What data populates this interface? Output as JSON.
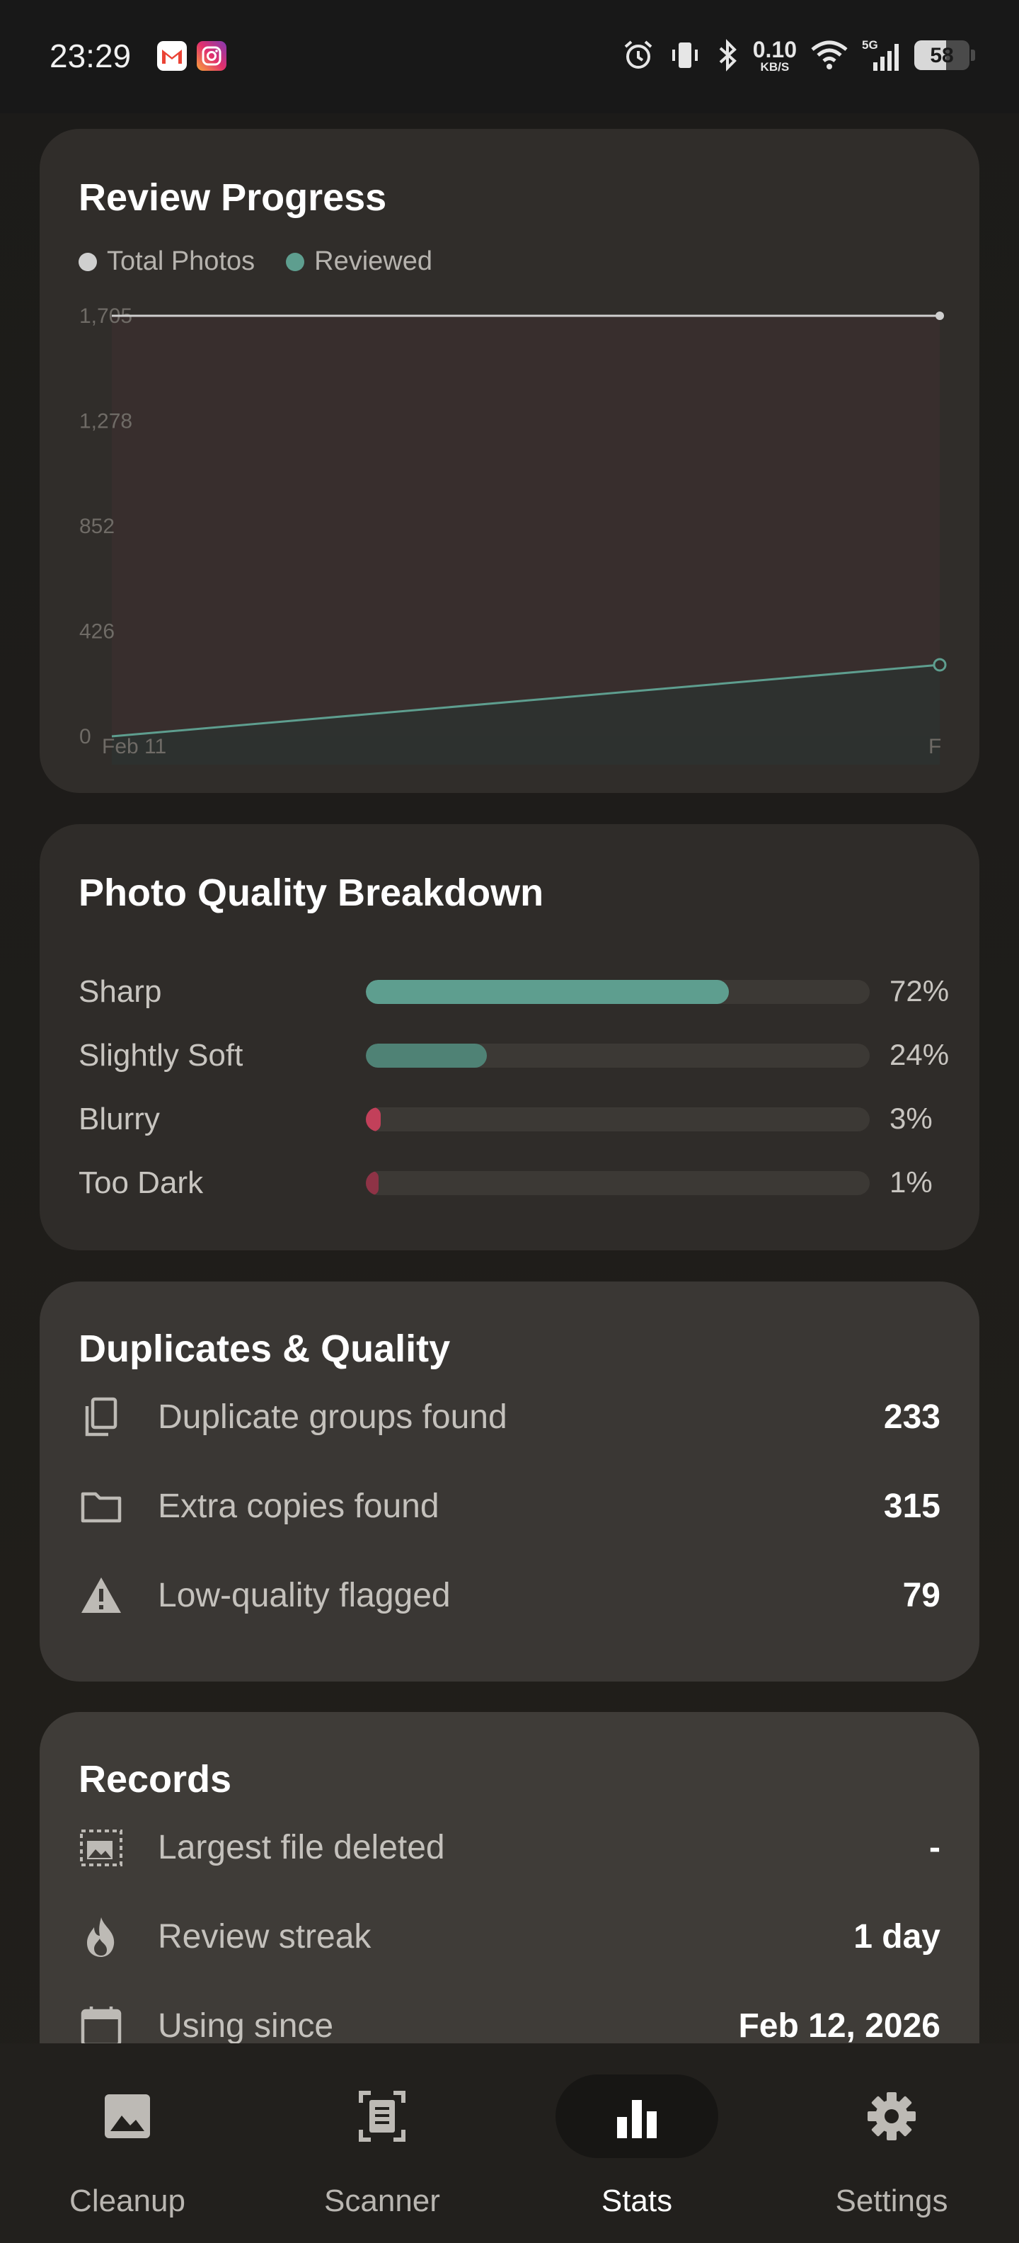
{
  "status_bar": {
    "time": "23:29",
    "notification_icons": [
      "gmail-icon",
      "instagram-icon"
    ],
    "net_speed_value": "0.10",
    "net_speed_unit": "KB/S",
    "network_label": "5G",
    "battery_percent": "58",
    "battery_level": 0.58,
    "icons": [
      "alarm-icon",
      "vibrate-icon",
      "bluetooth-icon",
      "wifi-icon",
      "signal-icon",
      "battery-icon"
    ]
  },
  "review_progress": {
    "title": "Review Progress",
    "legend": [
      {
        "label": "Total Photos",
        "color": "#cfcfcf"
      },
      {
        "label": "Reviewed",
        "color": "#5e9e8f"
      }
    ],
    "chart_data": {
      "type": "area",
      "title": "Review Progress",
      "y_ticks": [
        "1,705",
        "1,278",
        "852",
        "426",
        "0"
      ],
      "ylim": [
        0,
        1705
      ],
      "x_ticks": [
        "Feb 11",
        "F"
      ],
      "grid": false,
      "legend_position": "top-left",
      "series": [
        {
          "name": "Total Photos",
          "color": "#cfcfcf",
          "values": [
            1705,
            1705
          ]
        },
        {
          "name": "Reviewed",
          "color": "#5e9e8f",
          "values": [
            0,
            290
          ]
        }
      ]
    }
  },
  "quality_breakdown": {
    "title": "Photo Quality Breakdown",
    "rows": [
      {
        "label": "Sharp",
        "percent_text": "72%",
        "fraction": 0.72,
        "color": "#5e9e8f"
      },
      {
        "label": "Slightly Soft",
        "percent_text": "24%",
        "fraction": 0.24,
        "color": "#4f8275"
      },
      {
        "label": "Blurry",
        "percent_text": "3%",
        "fraction": 0.03,
        "color": "#c2405a"
      },
      {
        "label": "Too Dark",
        "percent_text": "1%",
        "fraction": 0.01,
        "color": "#8e3346"
      }
    ]
  },
  "duplicates": {
    "title": "Duplicates & Quality",
    "rows": [
      {
        "icon": "copy-icon",
        "label": "Duplicate groups found",
        "value": "233"
      },
      {
        "icon": "folder-icon",
        "label": "Extra copies found",
        "value": "315"
      },
      {
        "icon": "warning-icon",
        "label": "Low-quality flagged",
        "value": "79"
      }
    ]
  },
  "records": {
    "title": "Records",
    "rows": [
      {
        "icon": "image-frame-icon",
        "label": "Largest file deleted",
        "value": "-"
      },
      {
        "icon": "flame-icon",
        "label": "Review streak",
        "value": "1 day"
      },
      {
        "icon": "calendar-icon",
        "label": "Using since",
        "value": "Feb 12, 2026"
      }
    ]
  },
  "bottom_nav": {
    "items": [
      {
        "label": "Cleanup",
        "icon": "image-icon",
        "active": false
      },
      {
        "label": "Scanner",
        "icon": "scanner-icon",
        "active": false
      },
      {
        "label": "Stats",
        "icon": "bar-chart-icon",
        "active": true
      },
      {
        "label": "Settings",
        "icon": "gear-icon",
        "active": false
      }
    ]
  }
}
